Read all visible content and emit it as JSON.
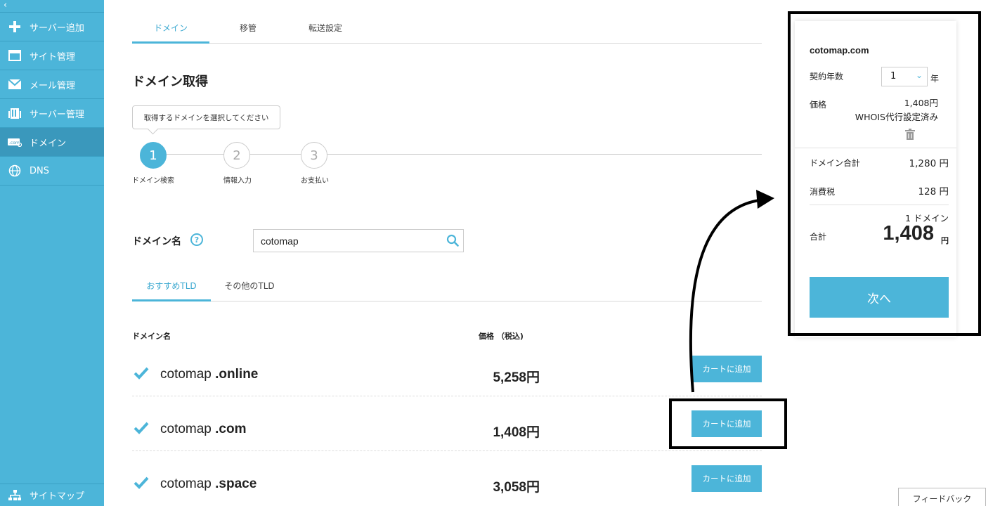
{
  "sidebar": {
    "collapse_icon": "chevron-left-icon",
    "items": [
      {
        "label": "サーバー追加",
        "icon": "plus-icon"
      },
      {
        "label": "サイト管理",
        "icon": "window-icon"
      },
      {
        "label": "メール管理",
        "icon": "mail-icon"
      },
      {
        "label": "サーバー管理",
        "icon": "server-icon"
      },
      {
        "label": "ドメイン",
        "icon": "domain-icon",
        "active": true
      },
      {
        "label": "DNS",
        "icon": "globe-icon"
      }
    ],
    "sitemap_label": "サイトマップ"
  },
  "tabs": [
    "ドメイン",
    "移管",
    "転送設定"
  ],
  "page_title": "ドメイン取得",
  "tooltip": "取得するドメインを選択してください",
  "steps": [
    {
      "number": "1",
      "label": "ドメイン検索"
    },
    {
      "number": "2",
      "label": "情報入力"
    },
    {
      "number": "3",
      "label": "お支払い"
    }
  ],
  "search": {
    "label": "ドメイン名",
    "help": "?",
    "value": "cotomap"
  },
  "subtabs": [
    "おすすめTLD",
    "その他のTLD"
  ],
  "table": {
    "headers": {
      "domain": "ドメイン名",
      "price": "価格 （税込)"
    },
    "rows": [
      {
        "name": "cotomap",
        "tld": ".online",
        "price": "5,258円",
        "button": "カートに追加"
      },
      {
        "name": "cotomap",
        "tld": ".com",
        "price": "1,408円",
        "button": "カートに追加"
      },
      {
        "name": "cotomap",
        "tld": ".space",
        "price": "3,058円",
        "button": "カートに追加"
      }
    ]
  },
  "cart": {
    "domain": "cotomap.com",
    "years_label": "契約年数",
    "years_value": "1",
    "years_unit": "年",
    "price_label": "価格",
    "price_value": "1,408円",
    "whois_note": "WHOIS代行設定済み",
    "subtotal_label": "ドメイン合計",
    "subtotal_value": "1,280 円",
    "tax_label": "消費税",
    "tax_value": "128 円",
    "count_label": "1 ドメイン",
    "total_label": "合計",
    "total_value": "1,408",
    "total_unit": "円",
    "next_button": "次へ"
  },
  "feedback_button": "フィードバック",
  "colors": {
    "accent": "#4cb5d9",
    "sidebar_active": "#3a98bc"
  }
}
